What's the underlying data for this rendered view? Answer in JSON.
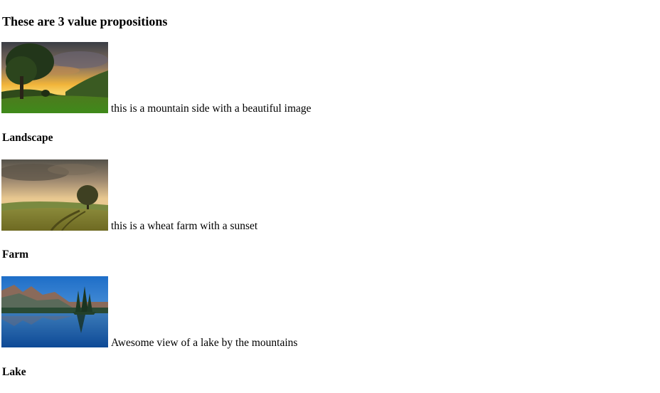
{
  "heading": "These are 3 value propositions",
  "propositions": [
    {
      "image_name": "landscape-image",
      "caption": "this is a mountain side with a beautiful image",
      "title": "Landscape"
    },
    {
      "image_name": "farm-image",
      "caption": "this is a wheat farm with a sunset",
      "title": "Farm"
    },
    {
      "image_name": "lake-image",
      "caption": "Awesome view of a lake by the mountains",
      "title": "Lake"
    }
  ]
}
